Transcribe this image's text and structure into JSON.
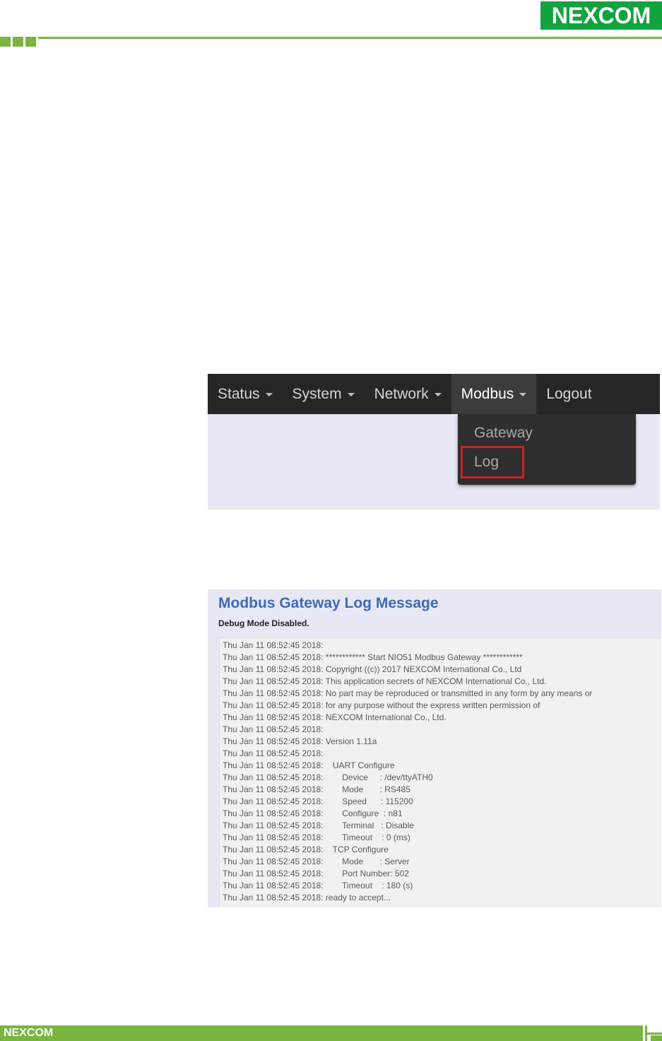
{
  "header": {
    "logo_text": "NEXCOM"
  },
  "navbar": {
    "items": [
      {
        "label": "Status",
        "caret": true
      },
      {
        "label": "System",
        "caret": true
      },
      {
        "label": "Network",
        "caret": true
      },
      {
        "label": "Modbus",
        "caret": true
      },
      {
        "label": "Logout",
        "caret": false
      }
    ],
    "dropdown": {
      "gateway_label": "Gateway",
      "log_label": "Log"
    }
  },
  "log_page": {
    "title": "Modbus Gateway Log Message",
    "status": "Debug Mode Disabled.",
    "lines": [
      "Thu Jan 11 08:52:45 2018:",
      "Thu Jan 11 08:52:45 2018: ************ Start NIO51 Modbus Gateway ************",
      "Thu Jan 11 08:52:45 2018: Copyright ((c)) 2017 NEXCOM International Co., Ltd",
      "Thu Jan 11 08:52:45 2018: This application secrets of NEXCOM International Co., Ltd.",
      "Thu Jan 11 08:52:45 2018: No part may be reproduced or transmitted in any form by any means or",
      "Thu Jan 11 08:52:45 2018: for any purpose without the express written permission of",
      "Thu Jan 11 08:52:45 2018: NEXCOM International Co., Ltd.",
      "Thu Jan 11 08:52:45 2018:",
      "Thu Jan 11 08:52:45 2018: Version 1.11a",
      "Thu Jan 11 08:52:45 2018:",
      "Thu Jan 11 08:52:45 2018:    UART Configure",
      "Thu Jan 11 08:52:45 2018:        Device     : /dev/ttyATH0",
      "Thu Jan 11 08:52:45 2018:        Mode       : RS485",
      "Thu Jan 11 08:52:45 2018:        Speed      : 115200",
      "Thu Jan 11 08:52:45 2018:        Configure  : n81",
      "Thu Jan 11 08:52:45 2018:        Terminal   : Disable",
      "Thu Jan 11 08:52:45 2018:        Timeout    : 0 (ms)",
      "Thu Jan 11 08:52:45 2018:    TCP Configure",
      "Thu Jan 11 08:52:45 2018:        Mode       : Server",
      "Thu Jan 11 08:52:45 2018:        Port Number: 502",
      "Thu Jan 11 08:52:45 2018:        Timeout    : 180 (s)",
      "Thu Jan 11 08:52:45 2018: ready to accept..."
    ]
  },
  "footer": {
    "logo_text": "NEXCOM"
  },
  "colors": {
    "brand_green": "#11a33e",
    "accent_green": "#7ab53f",
    "title_blue": "#3d6bb8",
    "highlight_red": "#d11f26"
  }
}
